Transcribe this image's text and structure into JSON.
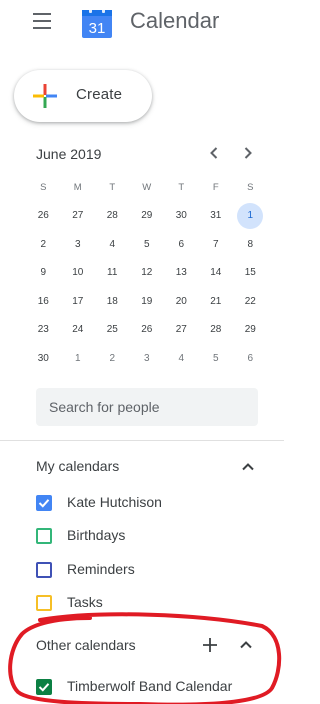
{
  "header": {
    "menu_icon": "hamburger-menu-icon",
    "logo_day": "31",
    "app_title": "Calendar"
  },
  "create_button": {
    "label": "Create",
    "icon": "colored-plus-icon"
  },
  "mini_calendar": {
    "month_label": "June 2019",
    "prev_icon": "chevron-left-icon",
    "next_icon": "chevron-right-icon",
    "weekdays": [
      "S",
      "M",
      "T",
      "W",
      "T",
      "F",
      "S"
    ],
    "weeks": [
      [
        "26",
        "27",
        "28",
        "29",
        "30",
        "31",
        "1"
      ],
      [
        "2",
        "3",
        "4",
        "5",
        "6",
        "7",
        "8"
      ],
      [
        "9",
        "10",
        "11",
        "12",
        "13",
        "14",
        "15"
      ],
      [
        "16",
        "17",
        "18",
        "19",
        "20",
        "21",
        "22"
      ],
      [
        "23",
        "24",
        "25",
        "26",
        "27",
        "28",
        "29"
      ],
      [
        "30",
        "1",
        "2",
        "3",
        "4",
        "5",
        "6"
      ]
    ],
    "today": "1"
  },
  "search": {
    "placeholder": "Search for people"
  },
  "my_calendars": {
    "title": "My calendars",
    "items": [
      {
        "label": "Kate Hutchison",
        "checked": true,
        "color": "#4285f4"
      },
      {
        "label": "Birthdays",
        "checked": false,
        "color": "#33b679"
      },
      {
        "label": "Reminders",
        "checked": false,
        "color": "#3f51b5"
      },
      {
        "label": "Tasks",
        "checked": false,
        "color": "#f6bf26"
      }
    ]
  },
  "other_calendars": {
    "title": "Other calendars",
    "items": [
      {
        "label": "Timberwolf Band Calendar",
        "checked": true,
        "color": "#0b8043"
      }
    ]
  },
  "annotation": {
    "color": "#e01b24"
  },
  "colors": {
    "google_blue": "#4285f4",
    "google_red": "#ea4335",
    "google_yellow": "#fbbc04",
    "google_green": "#34a853",
    "today_bg": "#d2e3fc"
  }
}
